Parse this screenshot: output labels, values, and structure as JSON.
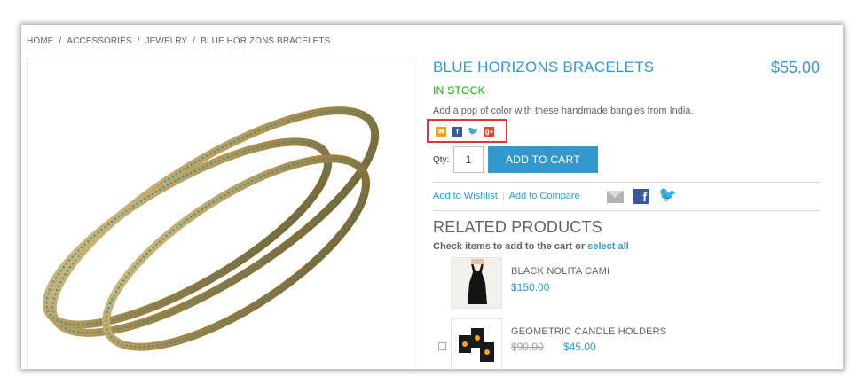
{
  "breadcrumb": [
    {
      "label": "HOME"
    },
    {
      "label": "ACCESSORIES"
    },
    {
      "label": "JEWELRY"
    },
    {
      "label": "BLUE HORIZONS BRACELETS"
    }
  ],
  "breadcrumb_separator": "/",
  "product": {
    "title": "BLUE HORIZONS BRACELETS",
    "price": "$55.00",
    "stock": "IN STOCK",
    "description": "Add a pop of color with these handmade bangles from India."
  },
  "share_icons": [
    "email-icon",
    "facebook-icon",
    "twitter-icon",
    "google-plus-icon"
  ],
  "cart": {
    "qty_label": "Qty:",
    "qty_value": "1",
    "add_to_cart": "ADD TO CART"
  },
  "links": {
    "wishlist": "Add to Wishlist",
    "separator": "|",
    "compare": "Add to Compare"
  },
  "related": {
    "title": "RELATED PRODUCTS",
    "instruction": "Check items to add to the cart or",
    "select_all": "select all",
    "items": [
      {
        "name": "BLACK NOLITA CAMI",
        "price": "$150.00"
      },
      {
        "name": "GEOMETRIC CANDLE HOLDERS",
        "old_price": "$90.00",
        "price": "$45.00"
      }
    ]
  },
  "colors": {
    "accent": "#3399cc",
    "stock": "#11b400",
    "highlight": "#d9373a"
  }
}
